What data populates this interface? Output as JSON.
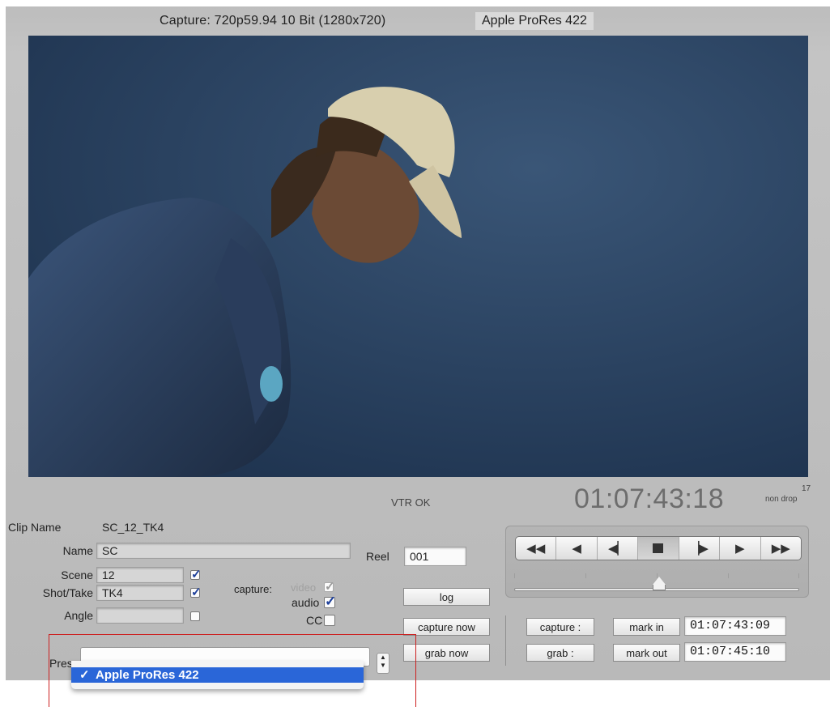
{
  "header": {
    "capture_format": "Capture: 720p59.94  10 Bit  (1280x720)",
    "codec": "Apple ProRes 422"
  },
  "status": {
    "vtr": "VTR OK"
  },
  "timecode": {
    "current": "01:07:43:18",
    "frame_rate_label": "17",
    "drop_mode": "non drop"
  },
  "clip": {
    "clip_name_label": "Clip Name",
    "clip_name_value": "SC_12_TK4",
    "name_label": "Name",
    "name_value": "SC",
    "scene_label": "Scene",
    "scene_value": "12",
    "shot_label": "Shot/Take",
    "shot_value": "TK4",
    "angle_label": "Angle",
    "angle_value": "",
    "reel_label": "Reel",
    "reel_value": "001",
    "preset_label": "Pres"
  },
  "capture_options": {
    "label": "capture:",
    "video_label": "video",
    "video_checked": true,
    "audio_label": "audio",
    "audio_checked": true,
    "cc_label": "CC",
    "cc_checked": false
  },
  "buttons": {
    "log": "log",
    "capture_now": "capture now",
    "grab_now": "grab now",
    "capture": "capture :",
    "grab": "grab :",
    "mark_in": "mark in",
    "mark_out": "mark out"
  },
  "marks": {
    "in": "01:07:43:09",
    "out": "01:07:45:10"
  },
  "transport": {
    "buttons": [
      "rewind",
      "play-reverse",
      "step-back",
      "stop",
      "step-forward",
      "play",
      "fast-forward"
    ],
    "active": "stop"
  },
  "preset_menu": {
    "selected_check": "✓",
    "selected_item": "Apple ProRes 422"
  }
}
